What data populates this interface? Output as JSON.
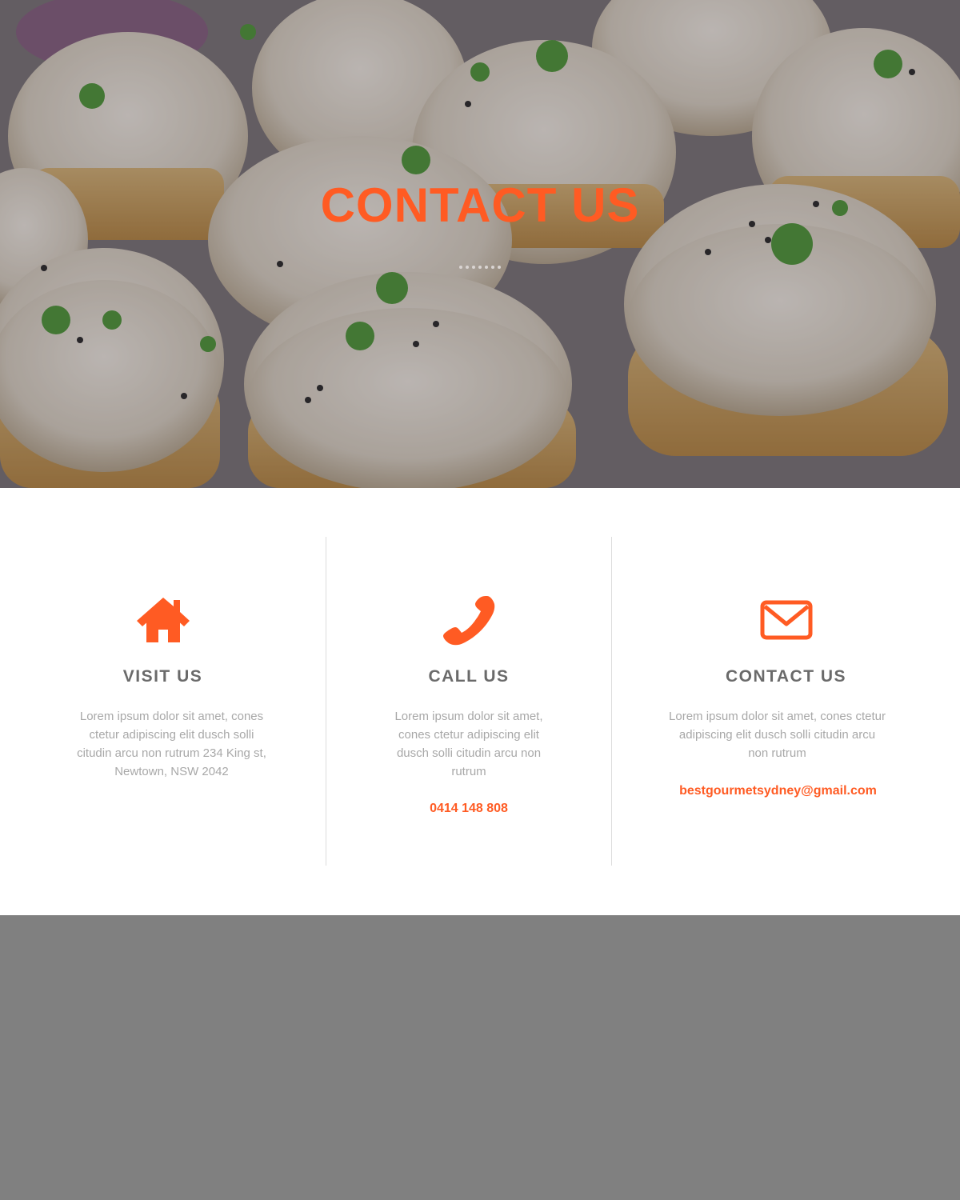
{
  "hero": {
    "title": "CONTACT US"
  },
  "cards": [
    {
      "icon": "home-icon",
      "title": "VISIT US",
      "text": "Lorem ipsum dolor sit amet, cones ctetur adipiscing elit dusch solli citudin arcu non rutrum 234 King st, Newtown, NSW 2042"
    },
    {
      "icon": "phone-icon",
      "title": "CALL US",
      "text": "Lorem ipsum dolor sit amet, cones ctetur adipiscing elit dusch solli citudin arcu non rutrum",
      "link": "0414 148 808"
    },
    {
      "icon": "envelope-icon",
      "title": "CONTACT US",
      "text": "Lorem ipsum dolor sit amet, cones ctetur adipiscing elit dusch solli citudin arcu non rutrum",
      "link": "bestgourmetsydney@gmail.com"
    }
  ],
  "colors": {
    "accent": "#ff5b23",
    "heading": "#6a6a6a",
    "body_text": "#a8a8a8",
    "footer_bg": "#808080"
  }
}
